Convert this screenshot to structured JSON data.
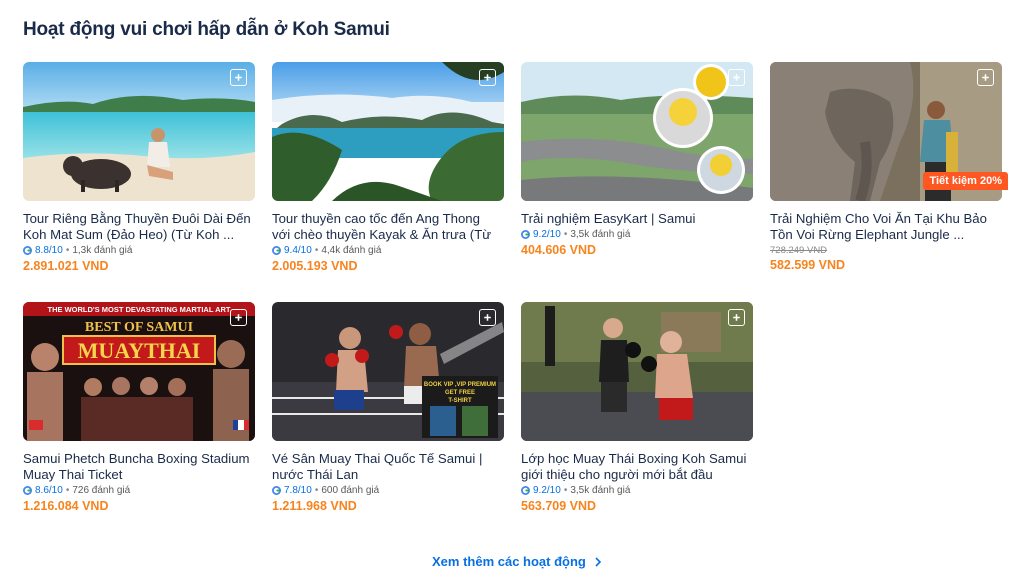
{
  "section": {
    "title": "Hoạt động vui chơi hấp dẫn ở Koh Samui",
    "see_more": "Xem thêm các hoạt động"
  },
  "colors": {
    "price": "#f7841d",
    "rating": "#0770e3",
    "link": "#0770e3",
    "badge": "#ff5722"
  },
  "cards": [
    {
      "title": "Tour Riêng Bằng Thuyền Đuôi Dài Đến Koh Mat Sum (Đảo Heo) (Từ Koh ...",
      "score": "8.8/10",
      "reviews": "1,3k đánh giá",
      "price": "2.891.021 VND"
    },
    {
      "title": "Tour thuyền cao tốc đến Ang Thong với chèo thuyền Kayak & Ăn trưa (Từ ...",
      "score": "9.4/10",
      "reviews": "4,4k đánh giá",
      "price": "2.005.193 VND"
    },
    {
      "title": "Trải nghiệm EasyKart | Samui",
      "score": "9.2/10",
      "reviews": "3,5k đánh giá",
      "price": "404.606 VND"
    },
    {
      "title": "Trải Nghiệm Cho Voi Ăn Tại Khu Bảo Tồn Voi Rừng Elephant Jungle ...",
      "old_price": "728.249 VND",
      "price": "582.599 VND",
      "badge": "Tiết kiệm 20%"
    },
    {
      "title": "Samui Phetch Buncha Boxing Stadium Muay Thai Ticket",
      "score": "8.6/10",
      "reviews": "726 đánh giá",
      "price": "1.216.084 VND",
      "poster": {
        "top": "THE WORLD'S MOST DEVASTATING MARTIAL ART",
        "line1": "BEST OF SAMUI",
        "line2": "MUAYTHAI"
      }
    },
    {
      "title": "Vé Sân Muay Thai Quốc Tế Samui | nước Thái Lan",
      "score": "7.8/10",
      "reviews": "600 đánh giá",
      "price": "1.211.968 VND",
      "poster": {
        "line1": "BOOK VIP ,VIP PREMIUM",
        "line2": "GET FREE",
        "line3": "T-SHIRT"
      }
    },
    {
      "title": "Lớp học Muay Thái Boxing Koh Samui giới thiệu cho người mới bắt đầu",
      "score": "9.2/10",
      "reviews": "3,5k đánh giá",
      "price": "563.709 VND"
    }
  ],
  "icons": {
    "save": "bookmark-plus-icon",
    "rating_source": "google-icon",
    "see_more": "chevron-right-icon"
  }
}
